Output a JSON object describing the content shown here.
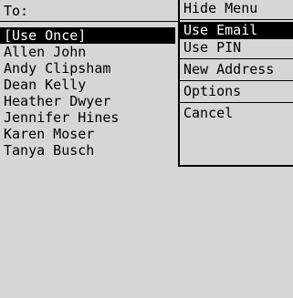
{
  "header": {
    "to_label": "To:"
  },
  "contacts": [
    {
      "label": "[Use Once]",
      "selected": true
    },
    {
      "label": "Allen John"
    },
    {
      "label": "Andy Clipsham"
    },
    {
      "label": "Dean Kelly"
    },
    {
      "label": "Heather Dwyer"
    },
    {
      "label": "Jennifer Hines"
    },
    {
      "label": "Karen Moser"
    },
    {
      "label": "Tanya Busch"
    }
  ],
  "menu": {
    "items": [
      {
        "label": "Hide Menu"
      },
      {
        "label": "Use Email",
        "active": true
      },
      {
        "label": "Use PIN"
      },
      {
        "label": "New Address"
      },
      {
        "label": "Options"
      },
      {
        "label": "Cancel"
      }
    ]
  }
}
